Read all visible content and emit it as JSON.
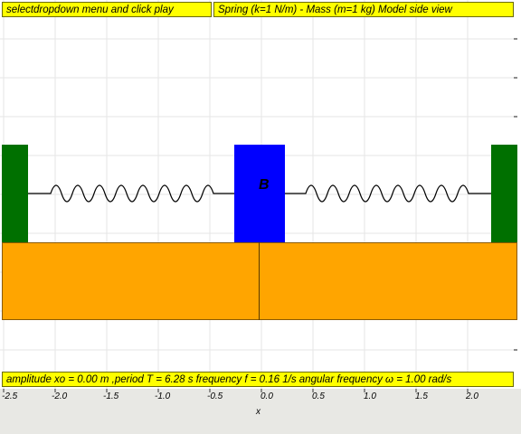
{
  "header": {
    "instruction": "selectdropdown menu and click play",
    "model_title": "Spring (k=1 N/m) - Mass (m=1 kg) Model side view"
  },
  "mass": {
    "label": "B"
  },
  "footer": {
    "info": "amplitude xo = 0.00 m ,period T = 6.28 s frequency f = 0.16 1/s angular frequency ω = 1.00 rad/s"
  },
  "axis": {
    "title": "x",
    "ticks": [
      "-2.5",
      "-2.0",
      "-1.5",
      "-1.0",
      "-0.5",
      "0.0",
      "0.5",
      "1.0",
      "1.5",
      "2.0"
    ]
  },
  "colors": {
    "wall": "#007000",
    "mass": "#0000ff",
    "floor": "#ffa500",
    "banner": "#ffff00"
  }
}
